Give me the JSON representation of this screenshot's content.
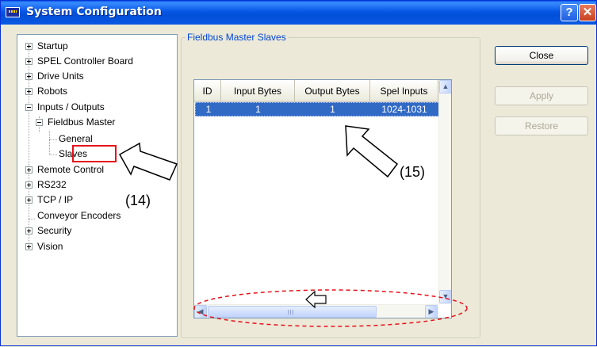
{
  "window": {
    "title": "System Configuration",
    "help_label": "?",
    "close_label": "✕"
  },
  "tree": {
    "items": [
      {
        "label": "Startup",
        "expander": "plus"
      },
      {
        "label": "SPEL Controller Board",
        "expander": "plus"
      },
      {
        "label": "Drive Units",
        "expander": "plus"
      },
      {
        "label": "Robots",
        "expander": "plus"
      },
      {
        "label": "Inputs / Outputs",
        "expander": "minus"
      },
      {
        "label": "Fieldbus Master",
        "expander": "minus"
      },
      {
        "label": "General",
        "expander": "none"
      },
      {
        "label": "Slaves",
        "expander": "none",
        "selected": true
      },
      {
        "label": "Remote Control",
        "expander": "plus"
      },
      {
        "label": "RS232",
        "expander": "plus"
      },
      {
        "label": "TCP / IP",
        "expander": "plus"
      },
      {
        "label": "Conveyor Encoders",
        "expander": "none"
      },
      {
        "label": "Security",
        "expander": "plus"
      },
      {
        "label": "Vision",
        "expander": "plus"
      }
    ]
  },
  "panel": {
    "group_title": "Fieldbus Master Slaves",
    "grid": {
      "columns": [
        "ID",
        "Input Bytes",
        "Output Bytes",
        "Spel Inputs"
      ],
      "rows": [
        [
          "1",
          "1",
          "1",
          "1024-1031"
        ]
      ]
    }
  },
  "buttons": {
    "close": "Close",
    "apply": "Apply",
    "restore": "Restore"
  },
  "annotations": {
    "callout_14": "(14)",
    "callout_15": "(15)",
    "highlight_color": "#e8101a"
  }
}
